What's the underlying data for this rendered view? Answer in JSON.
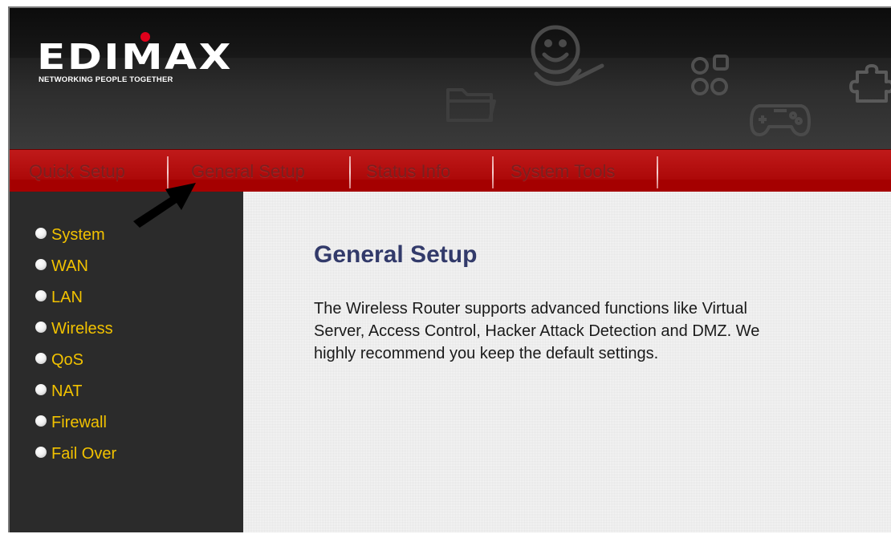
{
  "brand": {
    "name": "EDIMAX",
    "tagline": "NETWORKING PEOPLE TOGETHER",
    "accent_color": "#e0001b"
  },
  "nav": {
    "items": [
      {
        "label": "Quick Setup"
      },
      {
        "label": "General Setup",
        "active": true
      },
      {
        "label": "Status Info"
      },
      {
        "label": "System Tools"
      }
    ],
    "bar_color": "#b00c0c"
  },
  "sidebar": {
    "items": [
      {
        "label": "System"
      },
      {
        "label": "WAN"
      },
      {
        "label": "LAN"
      },
      {
        "label": "Wireless"
      },
      {
        "label": "QoS"
      },
      {
        "label": "NAT"
      },
      {
        "label": "Firewall"
      },
      {
        "label": "Fail Over"
      }
    ],
    "text_color": "#f2c200"
  },
  "main": {
    "title": "General Setup",
    "intro": "The Wireless Router supports advanced functions like Virtual Server, Access Control, Hacker Attack Detection and DMZ. We highly recommend you keep the default settings."
  },
  "icons": {
    "header_decorations": [
      "smiley-hand-icon",
      "folder-icon",
      "circles-icon",
      "gamepad-icon",
      "puzzle-icon"
    ],
    "pointer": "arrow-pointer-icon",
    "bullet": "radio-bullet-icon"
  }
}
